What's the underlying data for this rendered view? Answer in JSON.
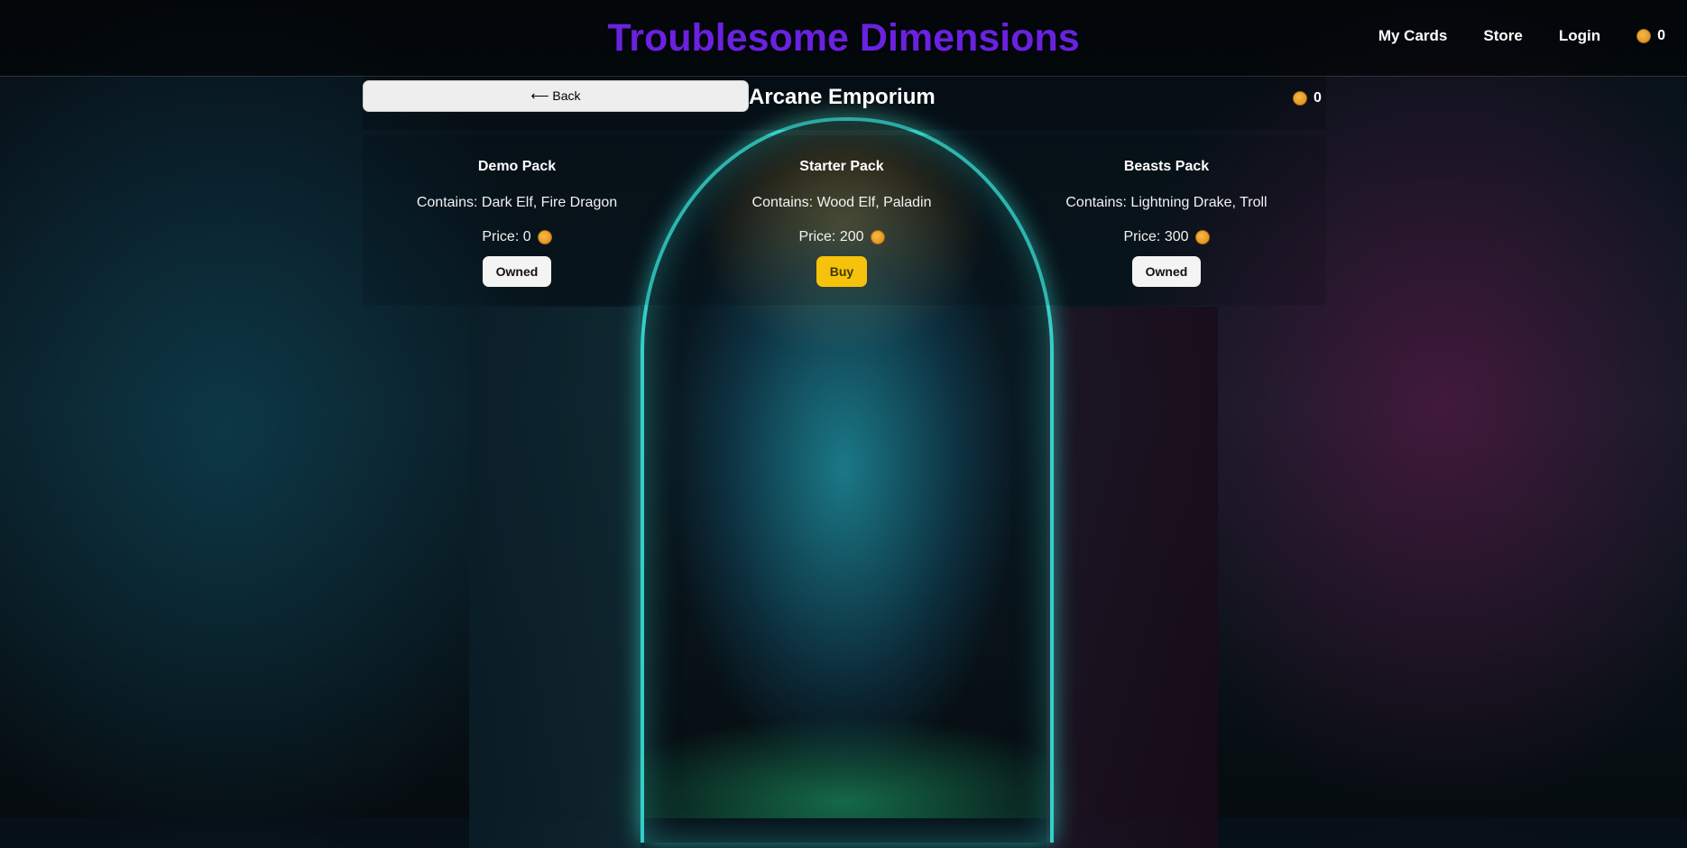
{
  "header": {
    "title": "Troublesome Dimensions",
    "nav": {
      "my_cards": "My Cards",
      "store": "Store",
      "login": "Login",
      "balance": "0"
    }
  },
  "store": {
    "back_label": "⟵ Back",
    "title": "Arcane Emporium",
    "balance": "0"
  },
  "packs": [
    {
      "name": "Demo Pack",
      "contents": "Contains: Dark Elf, Fire Dragon",
      "price": "Price: 0",
      "action": "Owned"
    },
    {
      "name": "Starter Pack",
      "contents": "Contains: Wood Elf, Paladin",
      "price": "Price: 200",
      "action": "Buy"
    },
    {
      "name": "Beasts Pack",
      "contents": "Contains: Lightning Drake, Troll",
      "price": "Price: 300",
      "action": "Owned"
    }
  ],
  "colors": {
    "title": "#6b21e0",
    "buy_button": "#f7c20c",
    "owned_button": "#f4f4f4",
    "coin": "#e9a12a"
  },
  "icons": {
    "currency": "coin-icon"
  }
}
